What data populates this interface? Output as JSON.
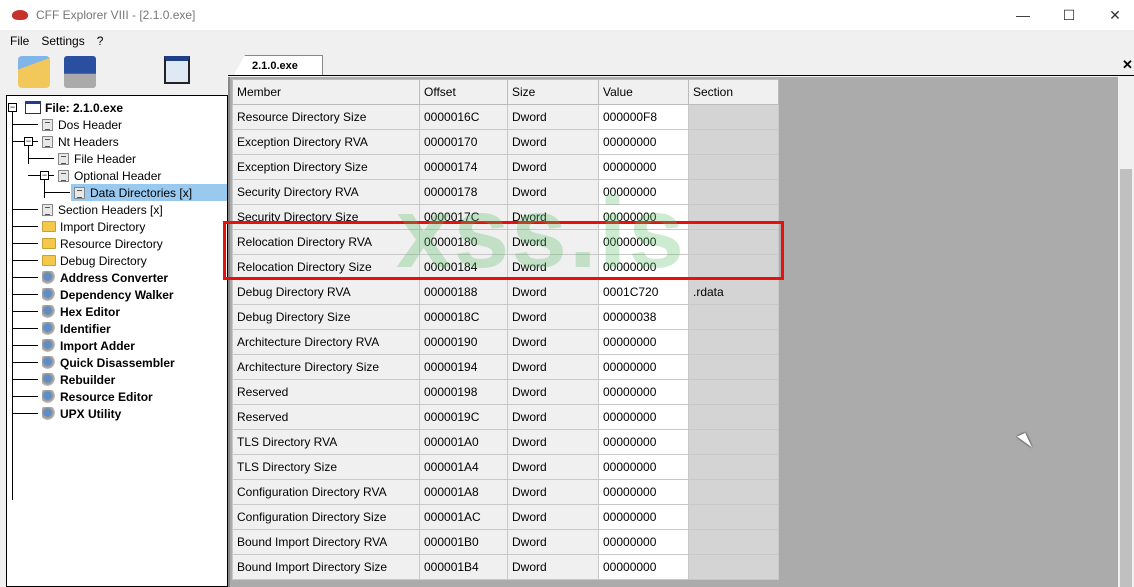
{
  "window": {
    "title": "CFF Explorer VIII - [2.1.0.exe]",
    "minimize": "—",
    "maximize": "☐",
    "close": "✕"
  },
  "menu": [
    "File",
    "Settings",
    "?"
  ],
  "toolbar": [
    "open-icon",
    "save-icon",
    "windows-icon"
  ],
  "tree": [
    {
      "label": "File: 2.1.0.exe",
      "icon": "window",
      "bold": true
    },
    {
      "label": "Dos Header",
      "icon": "doc"
    },
    {
      "label": "Nt Headers",
      "icon": "doc"
    },
    {
      "label": "File Header",
      "icon": "doc"
    },
    {
      "label": "Optional Header",
      "icon": "doc"
    },
    {
      "label": "Data Directories [x]",
      "icon": "doc",
      "selected": true
    },
    {
      "label": "Section Headers [x]",
      "icon": "doc"
    },
    {
      "label": "Import Directory",
      "icon": "folder"
    },
    {
      "label": "Resource Directory",
      "icon": "folder"
    },
    {
      "label": "Debug Directory",
      "icon": "folder"
    },
    {
      "label": "Address Converter",
      "icon": "tool",
      "bold": true
    },
    {
      "label": "Dependency Walker",
      "icon": "tool",
      "bold": true
    },
    {
      "label": "Hex Editor",
      "icon": "tool",
      "bold": true
    },
    {
      "label": "Identifier",
      "icon": "tool",
      "bold": true
    },
    {
      "label": "Import Adder",
      "icon": "tool",
      "bold": true
    },
    {
      "label": "Quick Disassembler",
      "icon": "tool",
      "bold": true
    },
    {
      "label": "Rebuilder",
      "icon": "tool",
      "bold": true
    },
    {
      "label": "Resource Editor",
      "icon": "tool",
      "bold": true
    },
    {
      "label": "UPX Utility",
      "icon": "tool",
      "bold": true
    }
  ],
  "tab": {
    "label": "2.1.0.exe",
    "close": "✕"
  },
  "grid": {
    "columns": [
      "Member",
      "Offset",
      "Size",
      "Value",
      "Section"
    ],
    "rows": [
      [
        "Resource Directory Size",
        "0000016C",
        "Dword",
        "000000F8",
        ""
      ],
      [
        "Exception Directory RVA",
        "00000170",
        "Dword",
        "00000000",
        ""
      ],
      [
        "Exception Directory Size",
        "00000174",
        "Dword",
        "00000000",
        ""
      ],
      [
        "Security Directory RVA",
        "00000178",
        "Dword",
        "00000000",
        ""
      ],
      [
        "Security Directory Size",
        "0000017C",
        "Dword",
        "00000000",
        ""
      ],
      [
        "Relocation Directory RVA",
        "00000180",
        "Dword",
        "00000000",
        ""
      ],
      [
        "Relocation Directory Size",
        "00000184",
        "Dword",
        "00000000",
        ""
      ],
      [
        "Debug Directory RVA",
        "00000188",
        "Dword",
        "0001C720",
        ".rdata"
      ],
      [
        "Debug Directory Size",
        "0000018C",
        "Dword",
        "00000038",
        ""
      ],
      [
        "Architecture Directory RVA",
        "00000190",
        "Dword",
        "00000000",
        ""
      ],
      [
        "Architecture Directory Size",
        "00000194",
        "Dword",
        "00000000",
        ""
      ],
      [
        "Reserved",
        "00000198",
        "Dword",
        "00000000",
        ""
      ],
      [
        "Reserved",
        "0000019C",
        "Dword",
        "00000000",
        ""
      ],
      [
        "TLS Directory RVA",
        "000001A0",
        "Dword",
        "00000000",
        ""
      ],
      [
        "TLS Directory Size",
        "000001A4",
        "Dword",
        "00000000",
        ""
      ],
      [
        "Configuration Directory RVA",
        "000001A8",
        "Dword",
        "00000000",
        ""
      ],
      [
        "Configuration Directory Size",
        "000001AC",
        "Dword",
        "00000000",
        ""
      ],
      [
        "Bound Import Directory RVA",
        "000001B0",
        "Dword",
        "00000000",
        ""
      ],
      [
        "Bound Import Directory Size",
        "000001B4",
        "Dword",
        "00000000",
        ""
      ]
    ]
  },
  "watermark": "xss.is",
  "colors": {
    "highlight": "#e8100c",
    "selection": "#99c9ef",
    "watermark": "#5abe64"
  }
}
